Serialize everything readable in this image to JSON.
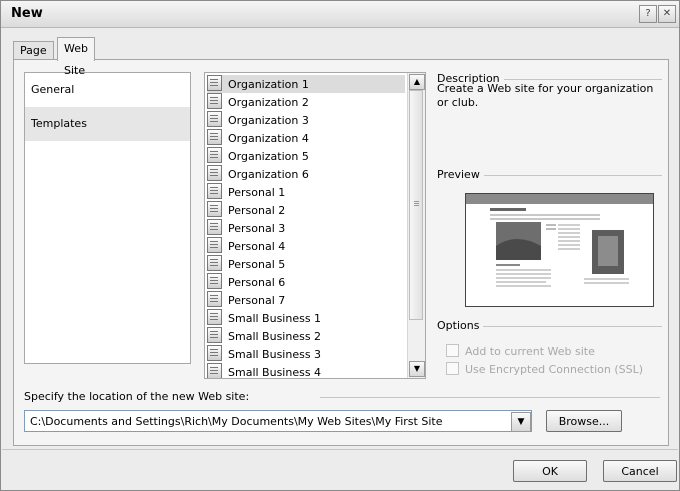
{
  "window": {
    "title": "New",
    "help_label": "?",
    "close_label": "✕"
  },
  "tabs": [
    {
      "label": "Page"
    },
    {
      "label": "Web Site",
      "active": true
    }
  ],
  "categories": [
    {
      "label": "General"
    },
    {
      "label": "Templates",
      "selected": true
    }
  ],
  "templates": [
    "Organization 1",
    "Organization 2",
    "Organization 3",
    "Organization 4",
    "Organization 5",
    "Organization 6",
    "Personal 1",
    "Personal 2",
    "Personal 3",
    "Personal 4",
    "Personal 5",
    "Personal 6",
    "Personal 7",
    "Small Business 1",
    "Small Business 2",
    "Small Business 3",
    "Small Business 4"
  ],
  "description": {
    "label": "Description",
    "text": "Create a Web site for your organization or club."
  },
  "preview": {
    "label": "Preview"
  },
  "options": {
    "label": "Options",
    "add_to_current": "Add to current Web site",
    "use_ssl": "Use Encrypted Connection (SSL)"
  },
  "location": {
    "label": "Specify the location of the new Web site:",
    "value": "C:\\Documents and Settings\\Rich\\My Documents\\My Web Sites\\My First Site",
    "browse_label": "Browse..."
  },
  "buttons": {
    "ok": "OK",
    "cancel": "Cancel"
  },
  "colors": {
    "dialog_bg": "#ececec",
    "panel_bg": "#f4f4f4",
    "disabled_text": "#a8a8a8"
  }
}
